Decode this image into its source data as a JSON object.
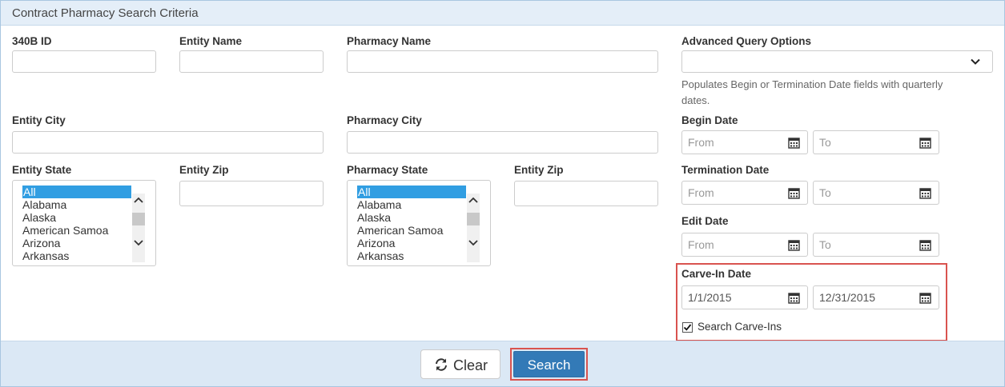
{
  "panel": {
    "title": "Contract Pharmacy Search Criteria"
  },
  "fields": {
    "id_340b": {
      "label": "340B ID",
      "value": ""
    },
    "entity_name": {
      "label": "Entity Name",
      "value": ""
    },
    "pharmacy_name": {
      "label": "Pharmacy Name",
      "value": ""
    },
    "entity_city": {
      "label": "Entity City",
      "value": ""
    },
    "pharmacy_city": {
      "label": "Pharmacy City",
      "value": ""
    },
    "entity_state": {
      "label": "Entity State"
    },
    "entity_zip": {
      "label": "Entity Zip",
      "value": ""
    },
    "pharmacy_state": {
      "label": "Pharmacy State"
    },
    "pharmacy_zip": {
      "label": "Entity Zip",
      "value": ""
    }
  },
  "states": [
    "All",
    "Alabama",
    "Alaska",
    "American Samoa",
    "Arizona",
    "Arkansas"
  ],
  "advanced": {
    "label": "Advanced Query Options",
    "value": "",
    "help_line1": "Populates Begin or Termination Date fields with quarterly",
    "help_line2": "dates."
  },
  "dates": {
    "from_placeholder": "From",
    "to_placeholder": "To",
    "begin": {
      "label": "Begin Date"
    },
    "termination": {
      "label": "Termination Date"
    },
    "edit": {
      "label": "Edit Date"
    },
    "carve_in": {
      "label": "Carve-In Date",
      "from": "1/1/2015",
      "to": "12/31/2015"
    }
  },
  "carve_in_checkbox": {
    "label": "Search Carve-Ins",
    "checked": true
  },
  "buttons": {
    "clear": "Clear",
    "search": "Search"
  },
  "colors": {
    "accent": "#337ab7",
    "highlight": "#d9534f",
    "selected_option": "#319ee2"
  }
}
